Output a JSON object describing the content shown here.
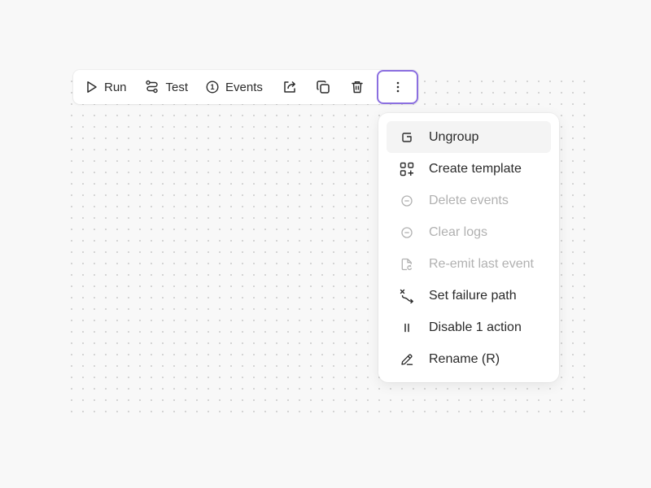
{
  "toolbar": {
    "run_label": "Run",
    "test_label": "Test",
    "events_label": "Events",
    "events_count": "1"
  },
  "menu": {
    "items": [
      {
        "label": "Ungroup",
        "icon": "ungroup-icon",
        "disabled": false,
        "hovered": true
      },
      {
        "label": "Create template",
        "icon": "template-icon",
        "disabled": false
      },
      {
        "label": "Delete events",
        "icon": "minus-circle-icon",
        "disabled": true
      },
      {
        "label": "Clear logs",
        "icon": "minus-circle-icon",
        "disabled": true
      },
      {
        "label": "Re-emit last event",
        "icon": "file-replay-icon",
        "disabled": true
      },
      {
        "label": "Set failure path",
        "icon": "failure-path-icon",
        "disabled": false
      },
      {
        "label": "Disable 1 action",
        "icon": "pause-icon",
        "disabled": false
      },
      {
        "label": "Rename (R)",
        "icon": "pencil-icon",
        "disabled": false
      }
    ]
  },
  "colors": {
    "accent": "#8b6fe0",
    "background": "#f8f8f8",
    "disabled_text": "#b1b1b1"
  }
}
